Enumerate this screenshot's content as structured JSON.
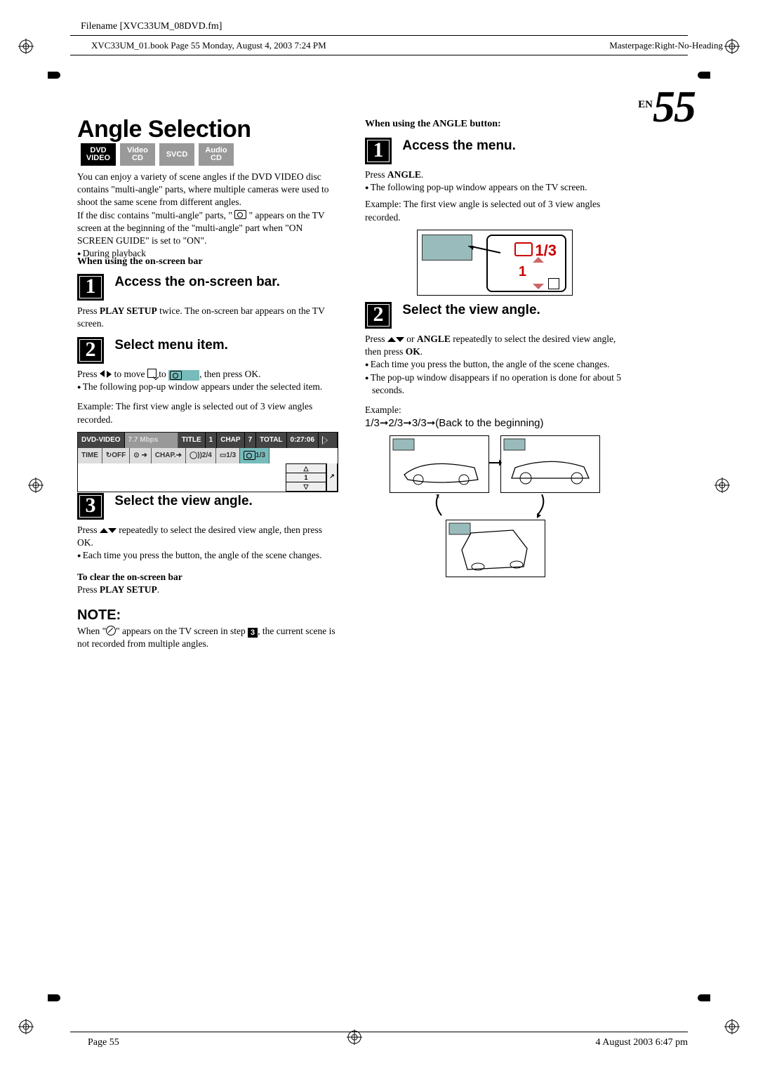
{
  "header": {
    "filename_label": "Filename [XVC33UM_08DVD.fm]",
    "book_line": "XVC33UM_01.book  Page 55  Monday, August 4, 2003  7:24 PM",
    "masterpage": "Masterpage:Right-No-Heading"
  },
  "page_marker": {
    "en": "EN",
    "num": "55"
  },
  "title": "Angle Selection",
  "badges": {
    "dvd_l1": "DVD",
    "dvd_l2": "VIDEO",
    "vcd_l1": "Video",
    "vcd_l2": "CD",
    "svcd": "SVCD",
    "acd_l1": "Audio",
    "acd_l2": "CD"
  },
  "left": {
    "intro1": "You can enjoy a variety of scene angles if the DVD VIDEO disc contains \"multi-angle\" parts, where multiple cameras were used to shoot the same scene from different angles.",
    "intro2a": "If the disc contains \"multi-angle\" parts, \" ",
    "intro2b": " \" appears on the TV screen at the beginning of the \"multi-angle\" part when \"ON SCREEN GUIDE\" is set to \"ON\".",
    "dur": "During playback",
    "sub_onscreen": "When using the on-screen bar",
    "step1_title": "Access the on-screen bar.",
    "step1_body": "Press PLAY SETUP twice. The on-screen bar appears on the TV screen.",
    "step2_title": "Select menu item.",
    "step2_pre": "Press ",
    "step2_mid": " to move ",
    "step2_mid2": " to ",
    "step2_post": ", then press OK.",
    "step2_b1": "The following pop-up window appears under the selected item.",
    "ex1": "Example: The first view angle is selected out of 3 view angles recorded.",
    "step3_title": "Select the view angle.",
    "step3_pre": "Press ",
    "step3_post": " repeatedly to select the desired view angle, then press OK.",
    "step3_b1": "Each time you press the button, the angle of the scene changes.",
    "clear_h": "To clear the on-screen bar",
    "clear_b": "Press PLAY SETUP.",
    "note_h": "NOTE:",
    "note_pre": "When \"",
    "note_mid": "\" appears on the TV screen in step ",
    "note_post": ", the current scene is not recorded from multiple angles."
  },
  "right": {
    "sub_button": "When using the ANGLE button:",
    "step1_title": "Access the menu.",
    "press_angle": "Press ANGLE.",
    "b1": "The following pop-up window appears on the TV screen.",
    "ex": "Example: The first view angle is selected out of 3 view angles recorded.",
    "popup_count": "1/3",
    "popup_one": "1",
    "step2_title": "Select the view angle.",
    "s2_pre": "Press ",
    "s2_mid": " or ANGLE repeatedly to select the desired view angle, then press OK.",
    "s2_b1": "Each time you press the button, the angle of the scene changes.",
    "s2_b2": "The pop-up window disappears if no operation is done for about 5 seconds.",
    "ex2": "Example:",
    "seq": "1/3➞2/3➞3/3➞(Back to the beginning)"
  },
  "osd": {
    "dvd": "DVD-VIDEO",
    "rate": "7.7 Mbps",
    "title": "TITLE",
    "t1": "1",
    "chap": "CHAP",
    "c7": "7",
    "total": "TOTAL",
    "time": "0:27:06",
    "r2_time": "TIME",
    "off": "OFF",
    "chaparr": "CHAP.",
    "a24": "2/4",
    "a13": "1/3",
    "ang13": "1/3",
    "one": "1"
  },
  "footer": {
    "page": "Page 55",
    "stamp": "4 August 2003 6:47 pm"
  }
}
